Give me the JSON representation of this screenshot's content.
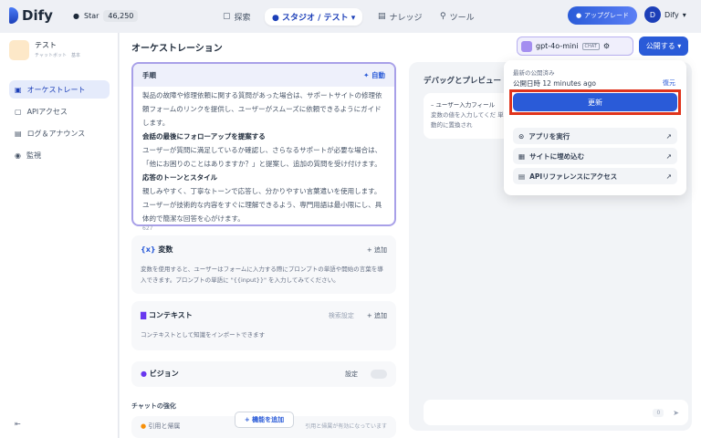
{
  "header": {
    "logo": "Dify",
    "star_label": "Star",
    "star_count": "46,250",
    "nav": [
      {
        "label": "探索",
        "icon": "explore-icon"
      },
      {
        "label": "スタジオ",
        "icon": "studio-icon"
      },
      {
        "label": "テスト"
      },
      {
        "label": "ナレッジ",
        "icon": "knowledge-icon"
      },
      {
        "label": "ツール",
        "icon": "tool-icon"
      }
    ],
    "upgrade": "アップグレード",
    "user_initial": "D",
    "user_name": "Dify"
  },
  "sidebar": {
    "app_name": "テスト",
    "app_type": "チャットボット",
    "app_mode": "基本",
    "items": [
      {
        "label": "オーケストレート",
        "active": true
      },
      {
        "label": "APIアクセス"
      },
      {
        "label": "ログ＆アナウンス"
      },
      {
        "label": "監視"
      }
    ]
  },
  "main": {
    "title": "オーケストレーション",
    "model": "gpt-4o-mini",
    "model_badge": "CHAT",
    "publish": "公開する",
    "prompt": {
      "label": "手順",
      "auto": "自動",
      "lines": [
        "製品の故障や修理依頼に関する質問があった場合は、サポートサイトの修理依頼フォームのリンクを提供し、ユーザーがスムーズに依頼できるようにガイドします。",
        "会話の最後にフォローアップを提案する",
        "ユーザーが質問に満足しているか確認し、さらなるサポートが必要な場合は、「他にお困りのことはありますか？」と提案し、追加の質問を受け付けます。",
        "応答のトーンとスタイル",
        "親しみやすく、丁寧なトーンで応答し、分かりやすい言葉遣いを使用します。ユーザーが技術的な内容をすぐに理解できるよう、専門用語は最小限にし、具体的で簡潔な回答を心がけます。"
      ],
      "count": "627"
    },
    "variables": {
      "label": "変数",
      "add": "+ 追加",
      "desc": "変数を使用すると、ユーザーはフォームに入力する際にプロンプトの単語や開始の言葉を導入できます。プロンプトの単語に \"{{input}}\" を入力してみてください。"
    },
    "context": {
      "label": "コンテキスト",
      "retrieval": "検索設定",
      "add": "+ 追加",
      "desc": "コンテキストとして知識をインポートできます"
    },
    "vision": {
      "label": "ビジョン",
      "settings": "設定",
      "enabled": false
    },
    "chat_enhance": "チャットの強化",
    "citation": "引用と帰属",
    "citation_desc": "引用と帰属が有効になっています",
    "add_feature": "+ 機能を追加"
  },
  "debug": {
    "title": "デバッグとプレビュー",
    "input_field": "ユーザー入力フィール",
    "input_desc": "変数の値を入力してくだ 単語が自動的に置換され",
    "count": "0"
  },
  "popover": {
    "latest": "最新の公開済み",
    "published_at": "公開日時 12 minutes ago",
    "restore": "復元",
    "update": "更新",
    "items": [
      {
        "label": "アプリを実行",
        "icon": "play-icon"
      },
      {
        "label": "サイトに埋め込む",
        "icon": "embed-icon"
      },
      {
        "label": "APIリファレンスにアクセス",
        "icon": "doc-icon"
      }
    ]
  },
  "colors": {
    "primary": "#2a5bd8",
    "highlight": "#e0341c"
  }
}
